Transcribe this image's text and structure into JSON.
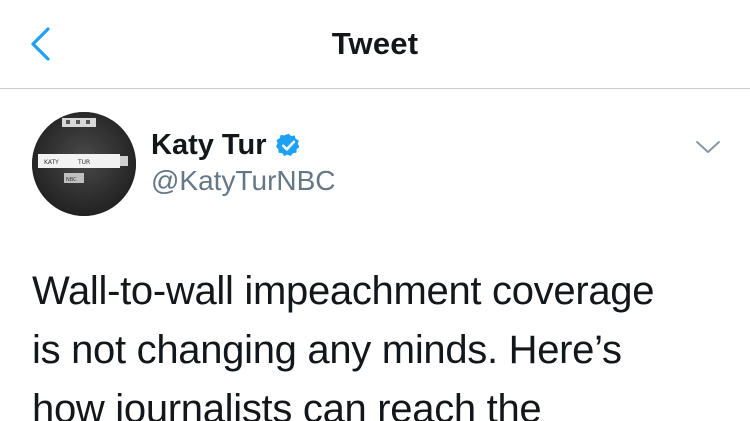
{
  "navbar": {
    "title": "Tweet",
    "back_icon": "chevron-left-icon",
    "accent_color": "#1DA1F2"
  },
  "tweet": {
    "author": {
      "display_name": "Katy Tur",
      "handle": "@KatyTurNBC",
      "verified": true,
      "verified_icon": "verified-badge-icon",
      "verified_color": "#1DA1F2",
      "avatar_texts": [
        "KATY",
        "TUR",
        "NBC"
      ]
    },
    "more_icon": "chevron-down-icon",
    "text_lines": [
      "Wall-to-wall impeachment coverage",
      "is not changing any minds. Here’s",
      "how journalists can reach the"
    ]
  }
}
